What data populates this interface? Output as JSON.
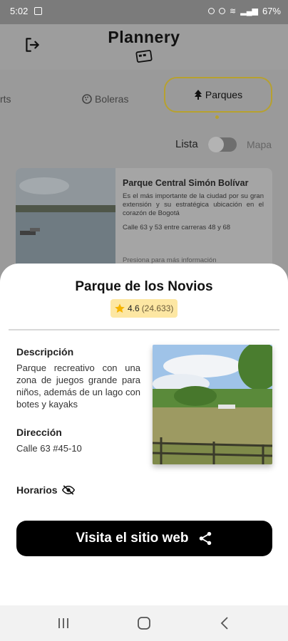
{
  "status_bar": {
    "time": "5:02",
    "battery": "67%"
  },
  "header": {
    "app_title": "Plannery"
  },
  "tabs": [
    {
      "label": "rts"
    },
    {
      "label": "Boleras"
    },
    {
      "label": "Parques",
      "active": true
    }
  ],
  "view_toggle": {
    "list_label": "Lista",
    "map_label": "Mapa",
    "state": "Lista"
  },
  "park_card": {
    "title": "Parque Central Simón Bolívar",
    "description": "Es el más importante de la ciudad por su gran extensión y su estratégica ubicación en el corazón de Bogotá",
    "address": "Calle 63 y 53 entre carreras 48 y 68",
    "more": "Presiona para más información"
  },
  "sheet": {
    "title": "Parque de los Novios",
    "rating": "4.6",
    "rating_count": "(24.633)",
    "description_label": "Descripción",
    "description": "Parque recreativo con una zona de juegos grande para niños, además de un lago con botes y kayaks",
    "address_label": "Dirección",
    "address": "Calle 63 #45-10",
    "hours_label": "Horarios",
    "web_button": "Visita el sitio web"
  },
  "colors": {
    "accent": "#b7a12f",
    "rating_bg": "#fde7a3",
    "button_bg": "#000000"
  },
  "icons": [
    "logout-icon",
    "bowling-icon",
    "tree-icon",
    "star-icon",
    "eye-off-icon",
    "share-icon"
  ]
}
